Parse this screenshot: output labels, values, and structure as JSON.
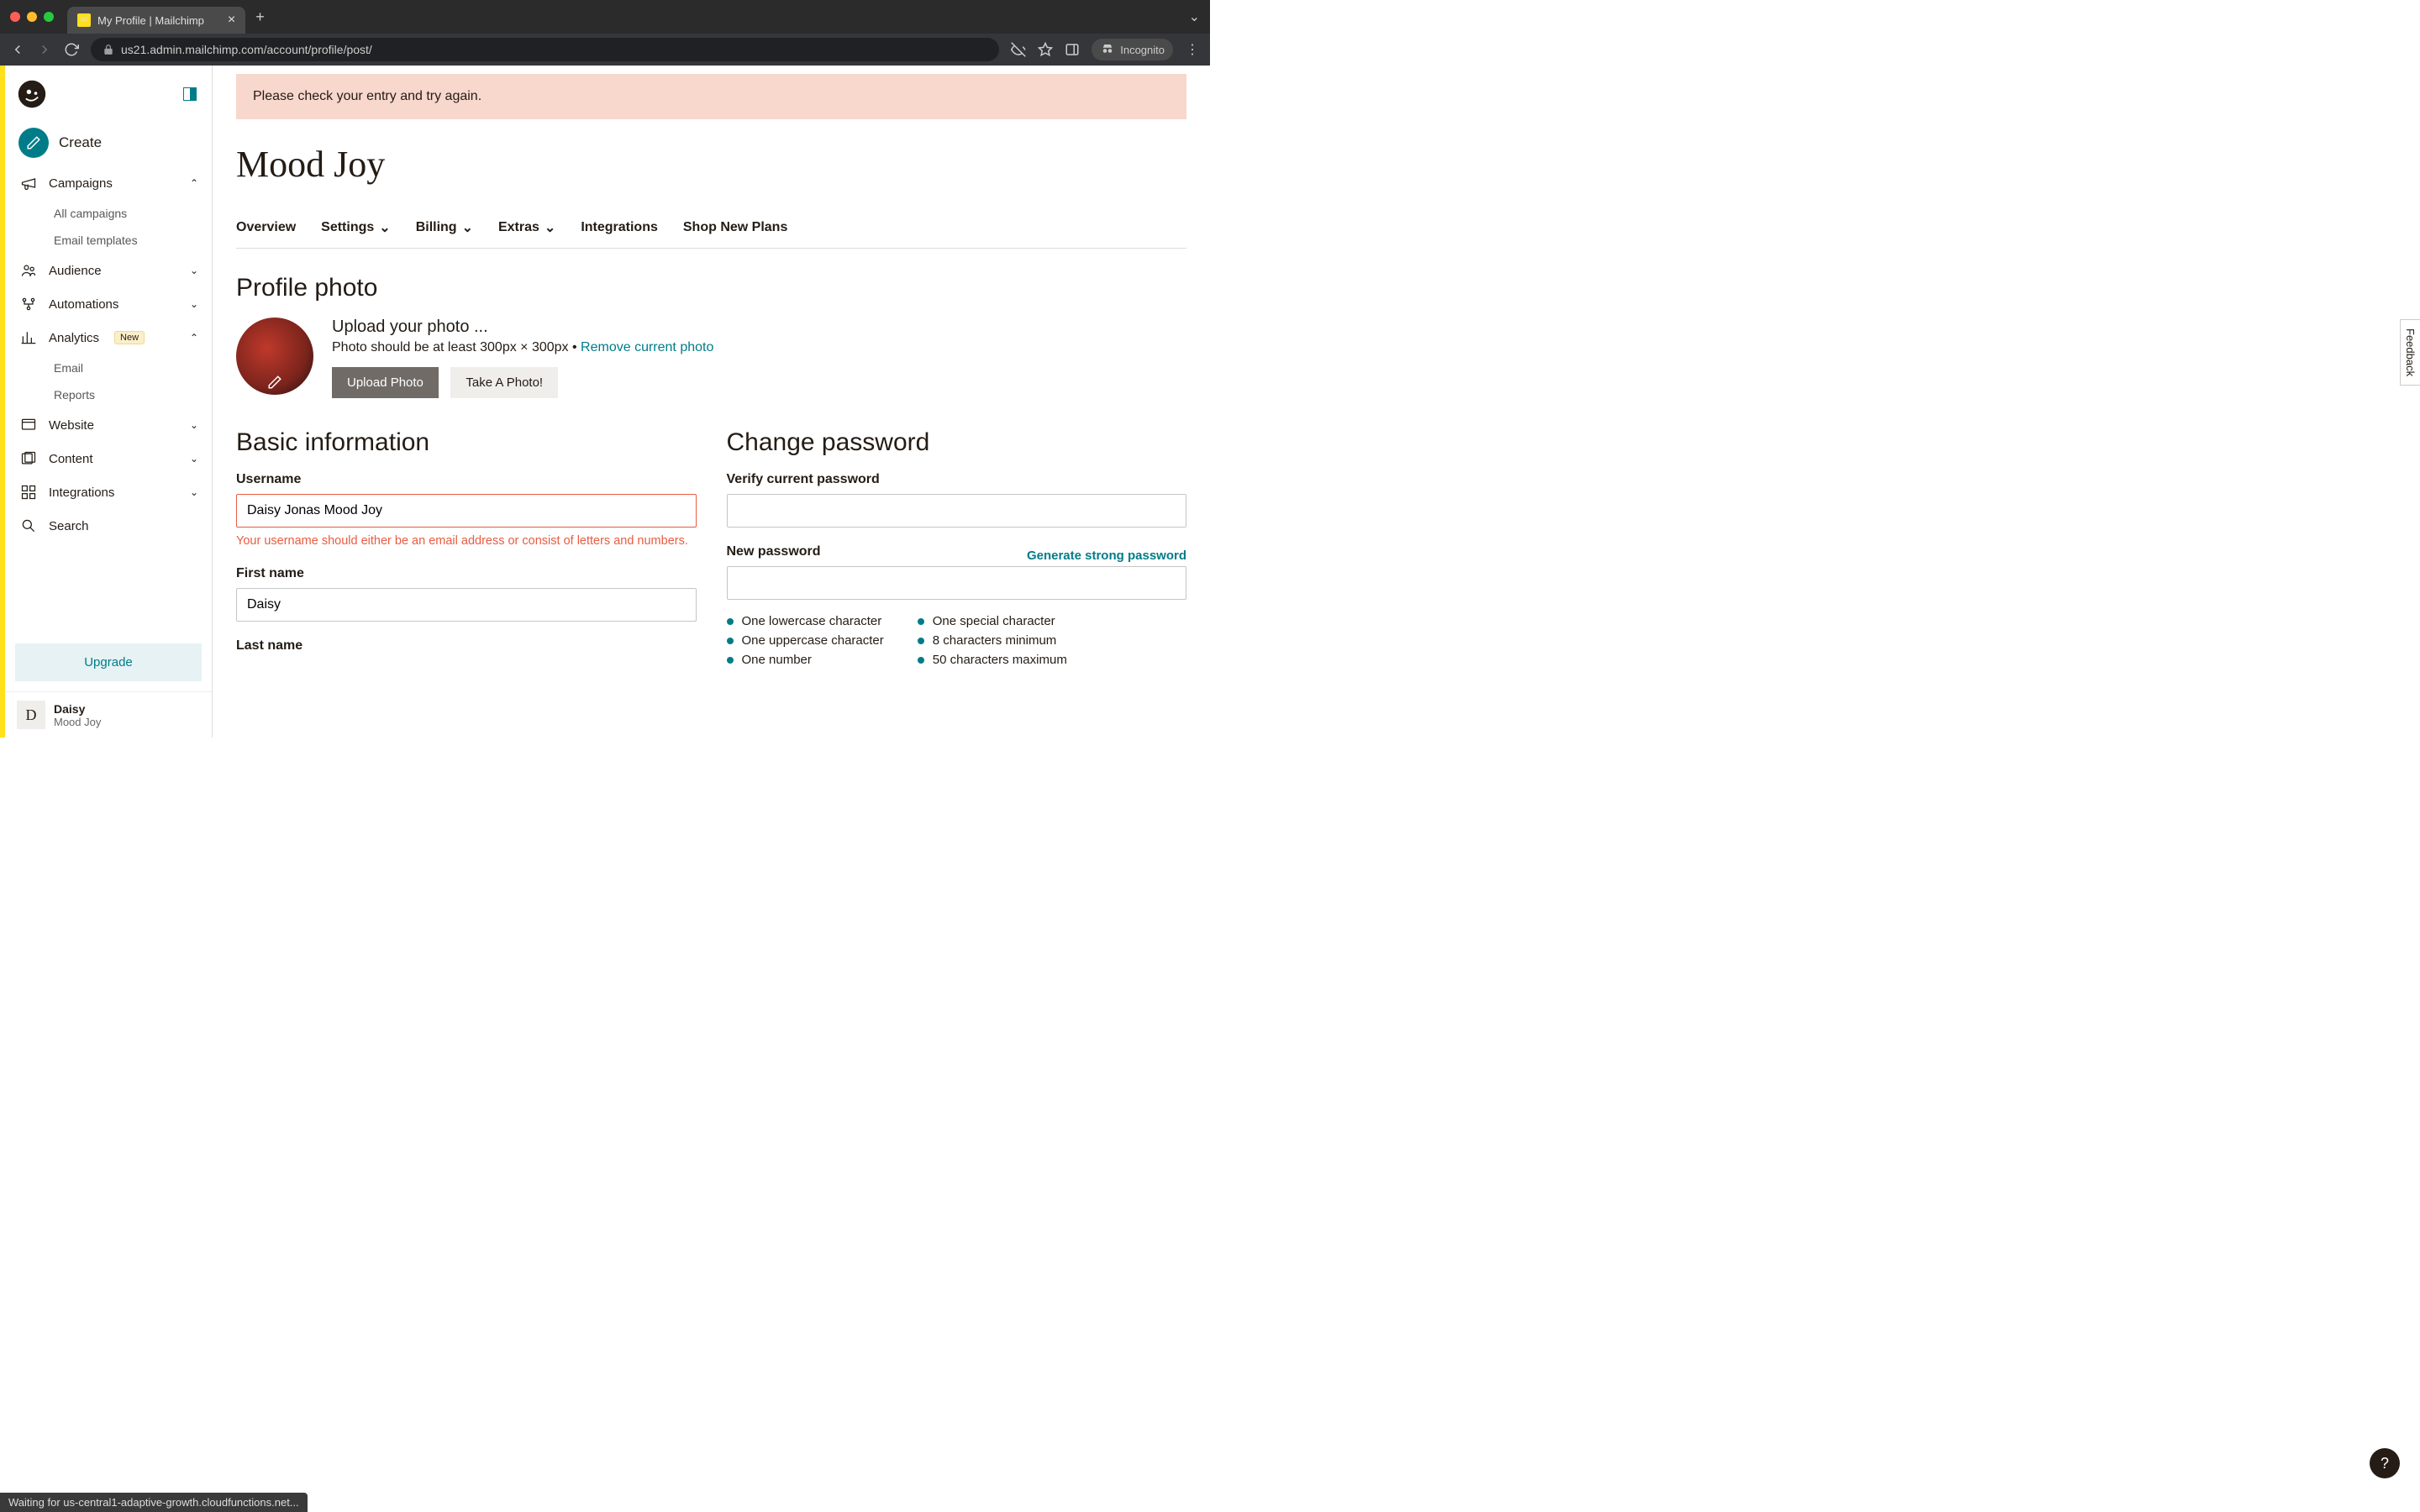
{
  "browser": {
    "tab_title": "My Profile | Mailchimp",
    "url": "us21.admin.mailchimp.com/account/profile/post/",
    "incognito_label": "Incognito"
  },
  "sidebar": {
    "create": "Create",
    "campaigns": "Campaigns",
    "campaigns_sub": [
      "All campaigns",
      "Email templates"
    ],
    "audience": "Audience",
    "automations": "Automations",
    "analytics": "Analytics",
    "analytics_badge": "New",
    "analytics_sub": [
      "Email",
      "Reports"
    ],
    "website": "Website",
    "content": "Content",
    "integrations": "Integrations",
    "search": "Search",
    "upgrade": "Upgrade",
    "user_name": "Daisy",
    "user_org": "Mood Joy",
    "user_initial": "D"
  },
  "main": {
    "alert": "Please check your entry and try again.",
    "page_title": "Mood Joy",
    "tabs": {
      "overview": "Overview",
      "settings": "Settings",
      "billing": "Billing",
      "extras": "Extras",
      "integrations": "Integrations",
      "shop": "Shop New Plans"
    },
    "profile_photo": {
      "heading": "Profile photo",
      "upload_title": "Upload your photo ...",
      "hint_prefix": "Photo should be at least 300px × 300px • ",
      "remove_link": "Remove current photo",
      "upload_btn": "Upload Photo",
      "take_btn": "Take A Photo!"
    },
    "basic_info": {
      "heading": "Basic information",
      "username_label": "Username",
      "username_value": "Daisy Jonas Mood Joy",
      "username_error": "Your username should either be an email address or consist of letters and numbers.",
      "firstname_label": "First name",
      "firstname_value": "Daisy",
      "lastname_label": "Last name"
    },
    "change_pw": {
      "heading": "Change password",
      "verify_label": "Verify current password",
      "new_label": "New password",
      "generate": "Generate strong password",
      "rules_left": [
        "One lowercase character",
        "One uppercase character",
        "One number"
      ],
      "rules_right": [
        "One special character",
        "8 characters minimum",
        "50 characters maximum"
      ]
    }
  },
  "feedback_label": "Feedback",
  "status_bar": "Waiting for us-central1-adaptive-growth.cloudfunctions.net..."
}
